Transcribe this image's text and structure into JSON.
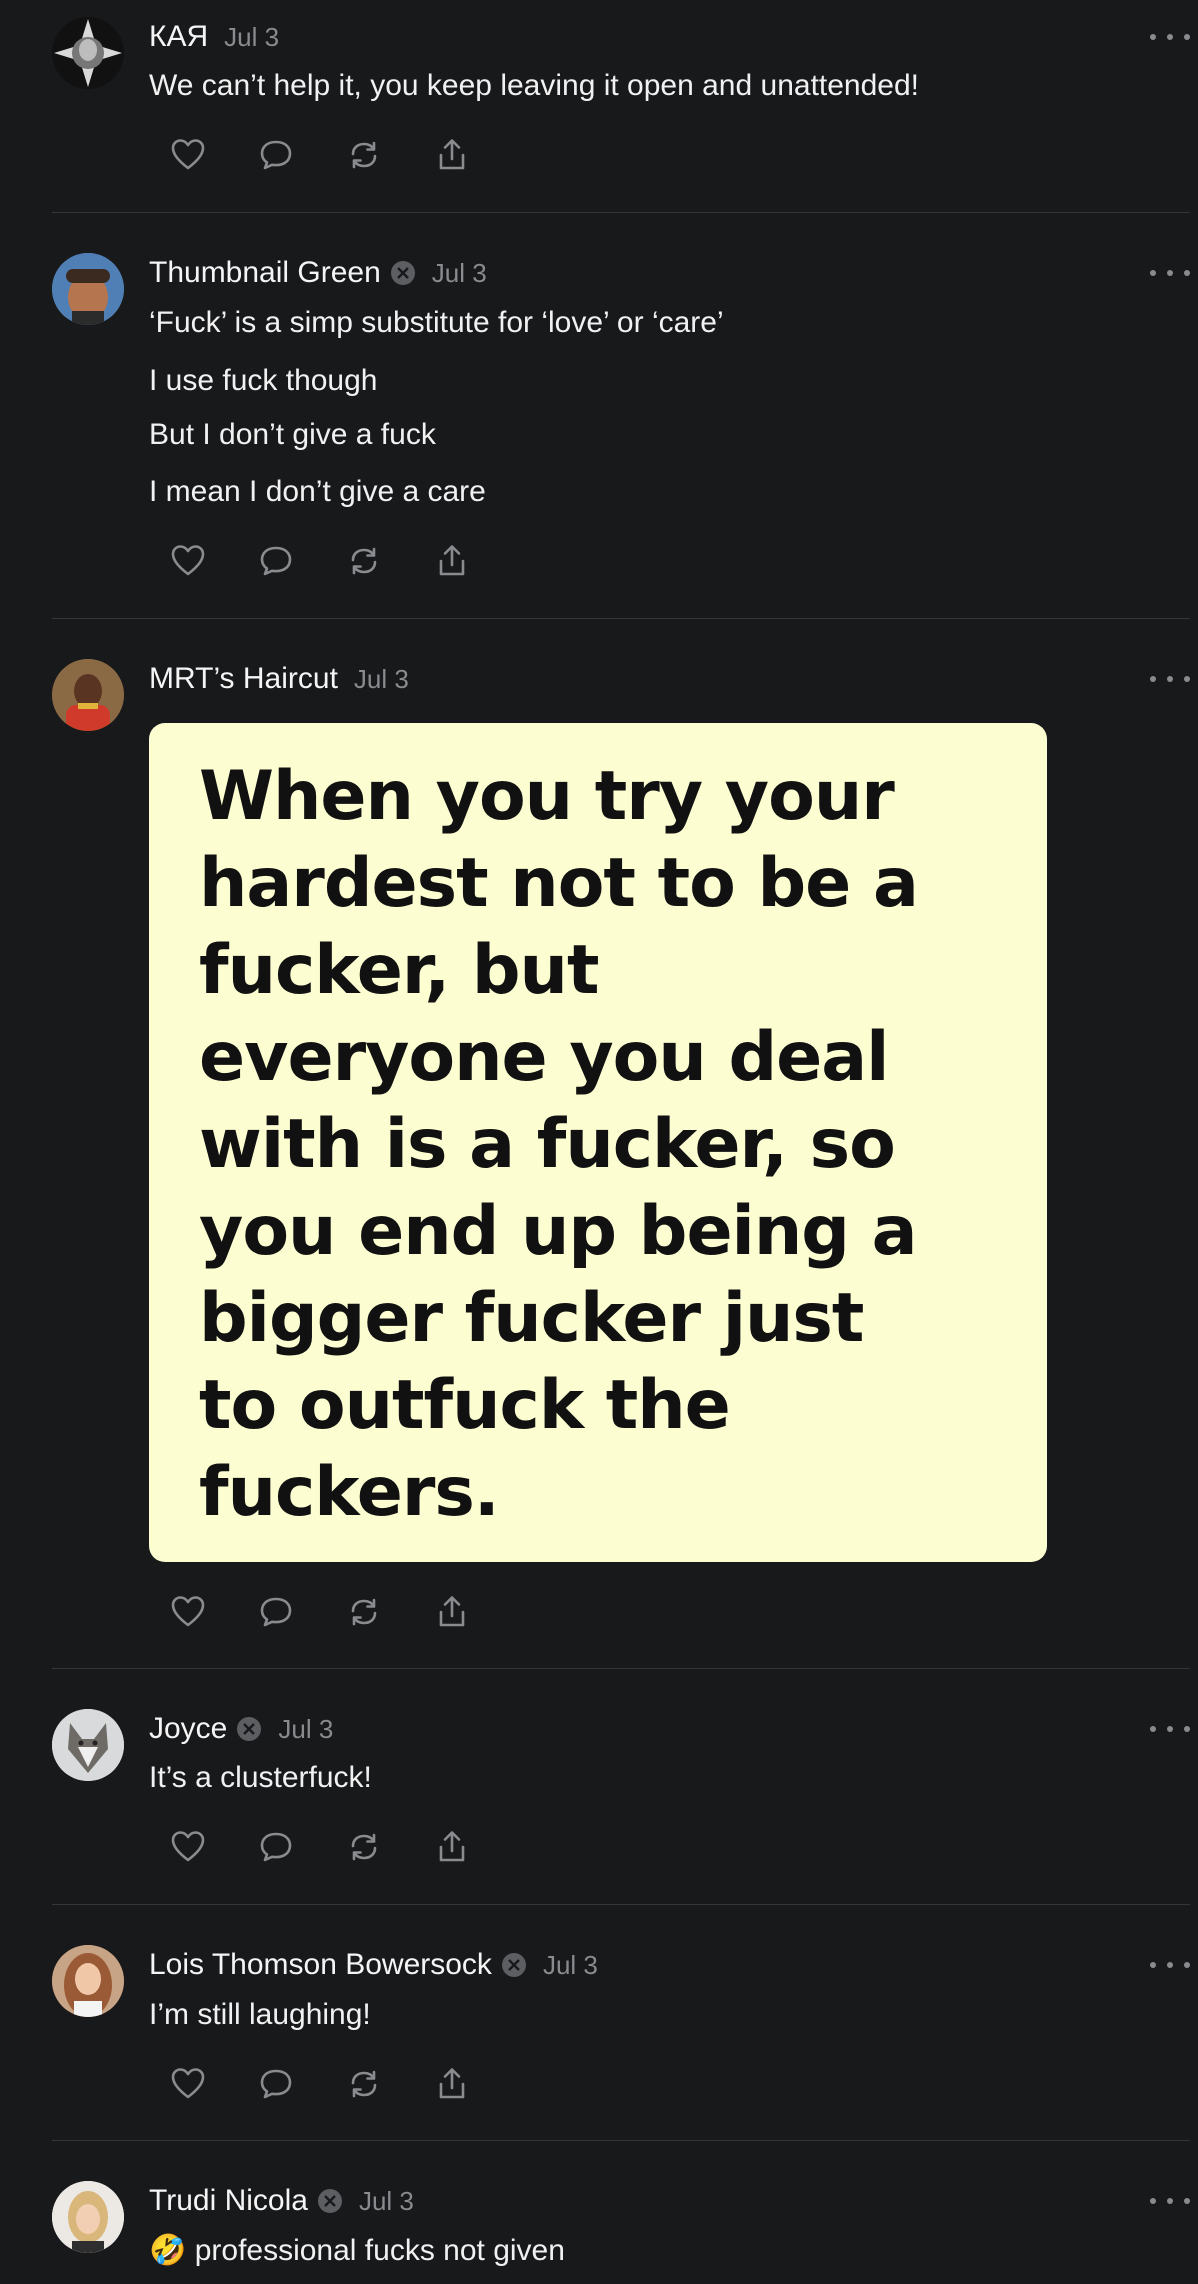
{
  "posts": [
    {
      "author": "КАЯ",
      "verified": false,
      "date": "Jul 3",
      "lines": [
        "We can’t help it, you keep leaving it open and unattended!"
      ]
    },
    {
      "author": "Thumbnail Green",
      "verified": true,
      "date": "Jul 3",
      "lines": [
        "‘Fuck’ is a simp substitute for ‘love’ or ‘care’",
        "I use fuck though",
        "But I don’t give a fuck",
        "I mean I don’t give a care"
      ]
    },
    {
      "author": "MRT’s Haircut",
      "verified": false,
      "date": "Jul 3",
      "image_text_lines": [
        "When you try your",
        "hardest not to be a",
        "fucker, but",
        "everyone you deal",
        "with is a fucker, so",
        "you end up being a",
        "bigger fucker just",
        "to outfuck the",
        "fuckers."
      ]
    },
    {
      "author": "Joyce",
      "verified": true,
      "date": "Jul 3",
      "lines": [
        "It’s a clusterfuck!"
      ]
    },
    {
      "author": "Lois Thomson Bowersock",
      "verified": true,
      "date": "Jul 3",
      "lines": [
        "I’m still laughing!"
      ]
    },
    {
      "author": "Trudi Nicola",
      "verified": true,
      "date": "Jul 3",
      "emoji": "🤣",
      "lines": [
        "professional fucks not given"
      ]
    }
  ],
  "icons": {
    "like": "heart-icon",
    "reply": "comment-bubble-icon",
    "repost": "repost-arrows-icon",
    "share": "share-upload-icon",
    "more": "more-dots-icon",
    "verified": "verified-badge-icon"
  },
  "colors": {
    "background": "#18191b",
    "text": "#f3f3f3",
    "muted": "#8a8b8f",
    "divider": "#35363a",
    "meme_background": "#fdfdd2"
  }
}
